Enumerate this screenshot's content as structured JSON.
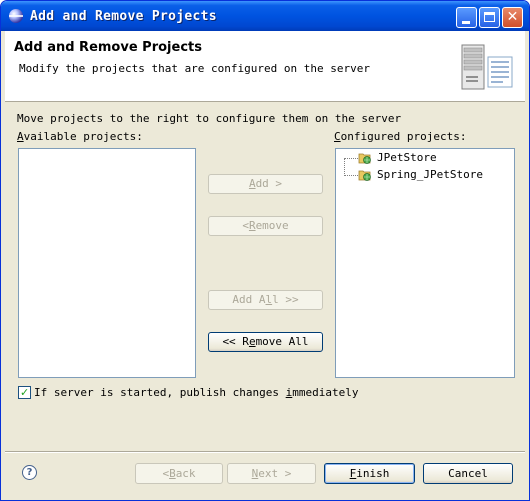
{
  "window": {
    "title": "Add and Remove Projects"
  },
  "header": {
    "title": "Add and Remove Projects",
    "description": "Modify the projects that are configured on the server"
  },
  "main": {
    "instruction": "Move projects to the right to configure them on the server",
    "available_label_mnemonic": "A",
    "available_label_rest": "vailable projects:",
    "configured_label_mnemonic": "C",
    "configured_label_rest": "onfigured projects:",
    "configured_projects": [
      "JPetStore",
      "Spring_JPetStore"
    ]
  },
  "buttons": {
    "add": {
      "pre": "",
      "mnemonic": "A",
      "post": "dd >",
      "enabled": false
    },
    "remove": {
      "pre": "< ",
      "mnemonic": "R",
      "post": "emove",
      "enabled": false
    },
    "add_all": {
      "pre": "Add A",
      "mnemonic": "l",
      "post": "l >>",
      "enabled": false
    },
    "remove_all": {
      "pre": "<< R",
      "mnemonic": "e",
      "post": "move All",
      "enabled": true
    }
  },
  "options": {
    "publish_pre": "If server is started, publish changes ",
    "publish_mnemonic": "i",
    "publish_post": "mmediately",
    "publish_checked": true
  },
  "footer": {
    "back": {
      "pre": "< ",
      "mnemonic": "B",
      "post": "ack",
      "enabled": false
    },
    "next": {
      "pre": "",
      "mnemonic": "N",
      "post": "ext >",
      "enabled": false
    },
    "finish": {
      "pre": "",
      "mnemonic": "F",
      "post": "inish",
      "enabled": true
    },
    "cancel": {
      "label": "Cancel",
      "enabled": true
    }
  },
  "colors": {
    "titlebar": "#0053e0",
    "dialog_bg": "#ece9d8",
    "list_border": "#7f9db9",
    "disabled_text": "#aca899"
  }
}
